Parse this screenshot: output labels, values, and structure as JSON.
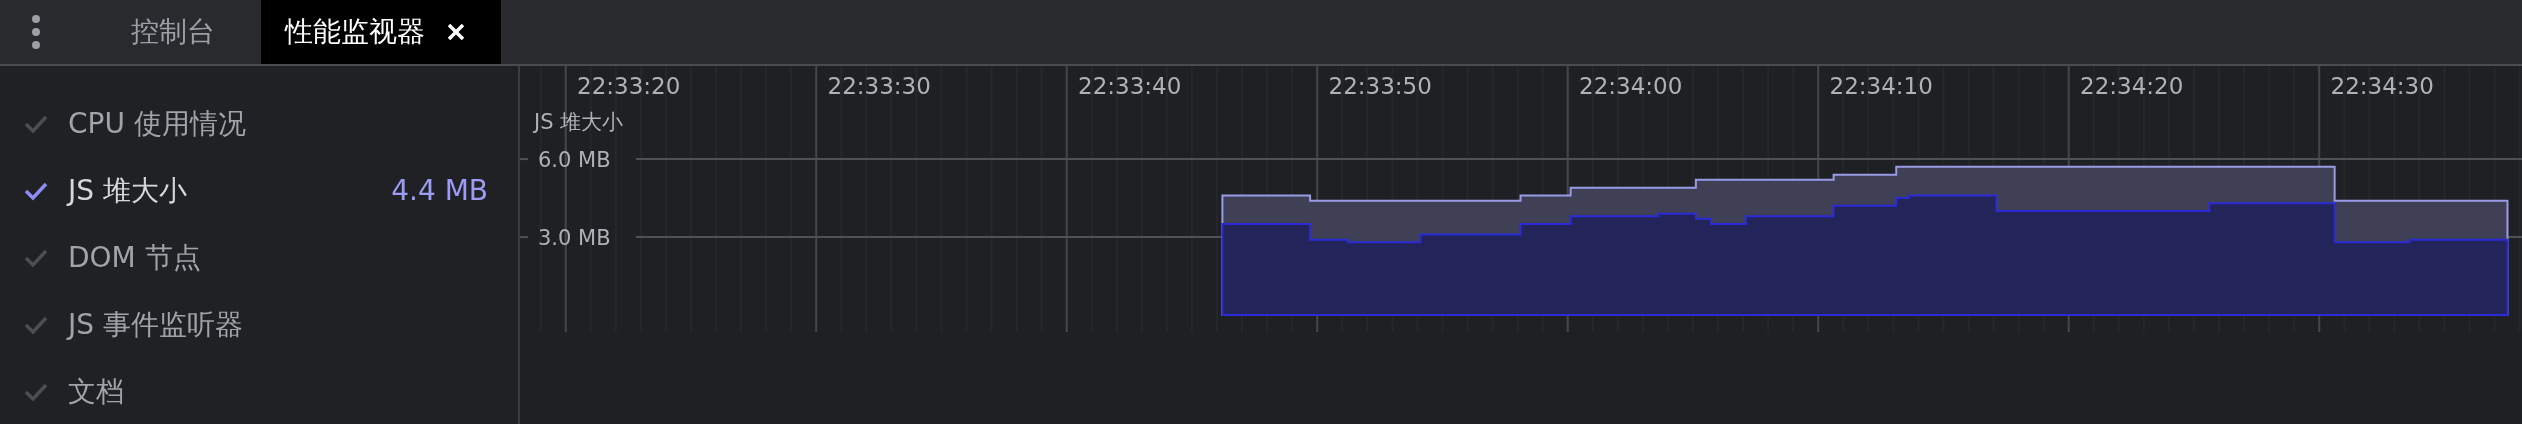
{
  "tabs": [
    {
      "label": "控制台",
      "selected": false,
      "closable": false
    },
    {
      "label": "性能监视器",
      "selected": true,
      "closable": true
    }
  ],
  "metrics": [
    {
      "label": "CPU 使用情况",
      "checked": false
    },
    {
      "label": "JS 堆大小",
      "checked": true,
      "value": "4.4 MB"
    },
    {
      "label": "DOM 节点",
      "checked": false
    },
    {
      "label": "JS 事件监听器",
      "checked": false
    },
    {
      "label": "文档",
      "checked": false
    }
  ],
  "chart": {
    "chart_data": {
      "type": "area",
      "ylabel": "JS 堆大小",
      "grid": true,
      "x": [
        81223.7,
        81227.1,
        81227.3,
        81228.6,
        81228.8,
        81231.5,
        81231.7,
        81235.5,
        81235.7,
        81237.5,
        81237.7,
        81241.0,
        81241.2,
        81242.5,
        81242.7,
        81243.1,
        81243.3,
        81244.5,
        81244.7,
        81248.0,
        81248.2,
        81250.5,
        81250.7,
        81251.0,
        81251.2,
        81254.5,
        81254.7,
        81263.0,
        81263.2,
        81268.0,
        81268.2,
        81271.0,
        81271.2,
        81275.0
      ],
      "series": [
        {
          "color": "#9a9be6",
          "values": [
            4.6,
            4.6,
            4.4,
            4.4,
            4.4,
            4.4,
            4.4,
            4.4,
            4.6,
            4.6,
            4.9,
            4.9,
            4.9,
            4.9,
            5.2,
            5.2,
            5.2,
            5.2,
            5.2,
            5.2,
            5.4,
            5.4,
            5.7,
            5.7,
            5.7,
            5.7,
            5.7,
            5.7,
            5.7,
            5.7,
            4.4,
            4.4,
            4.4,
            4.4
          ]
        },
        {
          "color": "#2a2ad6",
          "values": [
            3.5,
            3.5,
            2.9,
            2.9,
            2.8,
            2.8,
            3.1,
            3.1,
            3.5,
            3.5,
            3.8,
            3.8,
            3.9,
            3.9,
            3.7,
            3.7,
            3.5,
            3.5,
            3.8,
            3.8,
            4.2,
            4.2,
            4.5,
            4.5,
            4.6,
            4.6,
            4.0,
            4.0,
            4.3,
            4.3,
            2.8,
            2.8,
            2.9,
            2.9
          ]
        }
      ],
      "xlim": [
        81195.66,
        81275.58
      ],
      "ylim": [
        -4.23,
        9.58
      ],
      "xticks": [
        {
          "value": 81200,
          "label": "22:33:20"
        },
        {
          "value": 81210,
          "label": "22:33:30"
        },
        {
          "value": 81220,
          "label": "22:33:40"
        },
        {
          "value": 81230,
          "label": "22:33:50"
        },
        {
          "value": 81240,
          "label": "22:34:00"
        },
        {
          "value": 81250,
          "label": "22:34:10"
        },
        {
          "value": 81260,
          "label": "22:34:20"
        },
        {
          "value": 81270,
          "label": "22:34:30"
        }
      ],
      "yticks": [
        {
          "value": 3,
          "label": "3.0 MB"
        },
        {
          "value": 6,
          "label": "6.0 MB"
        }
      ]
    }
  }
}
